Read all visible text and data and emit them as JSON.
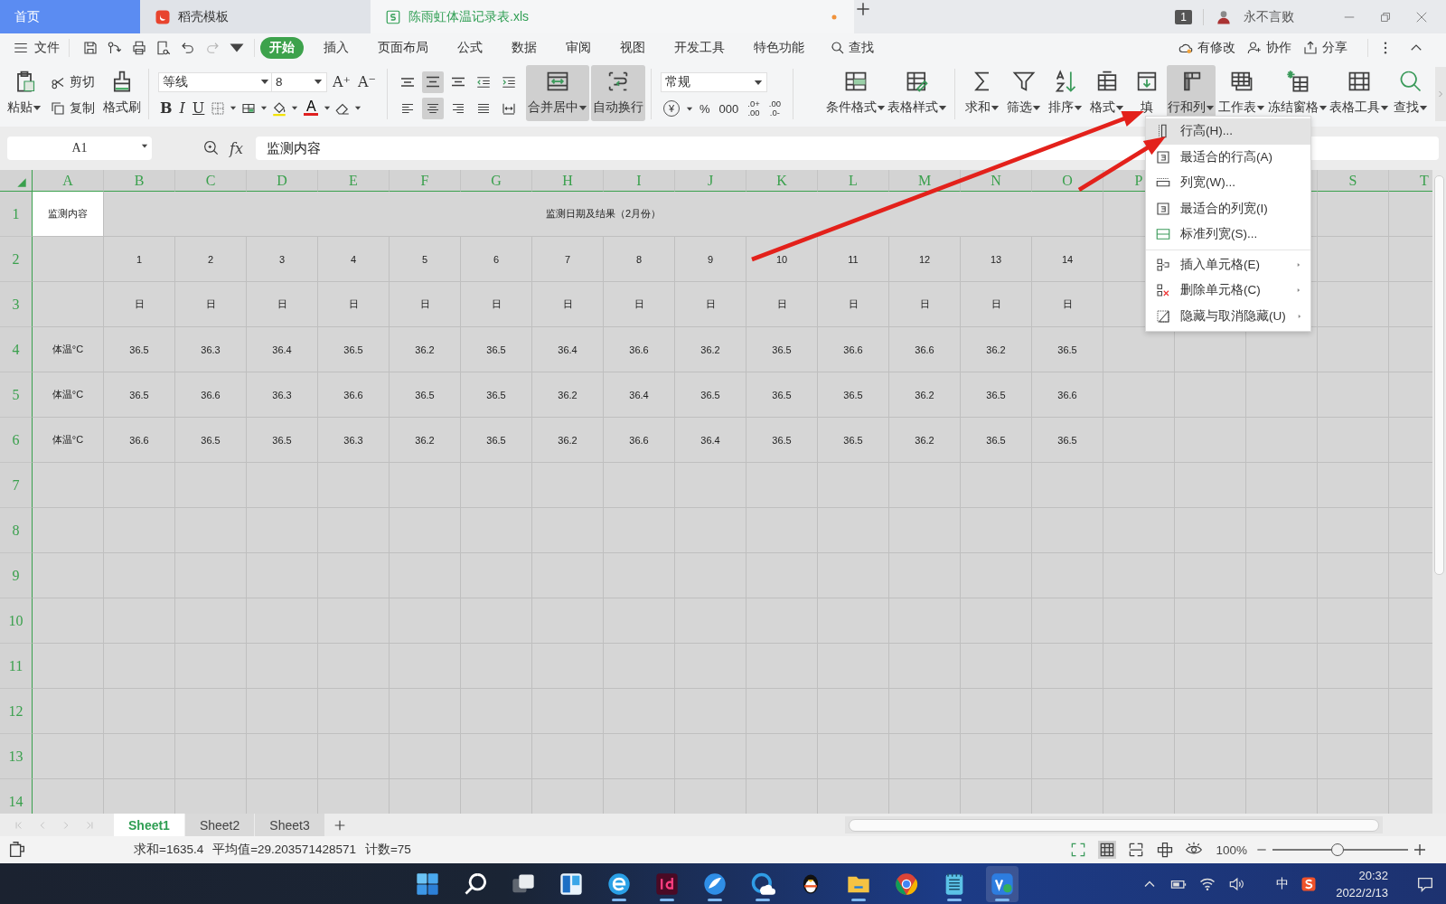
{
  "title_bar": {
    "tabs": [
      {
        "label": "首页",
        "selected": false,
        "kind": "home",
        "modified": false
      },
      {
        "label": "稻壳模板",
        "selected": false,
        "kind": "docer",
        "modified": false
      },
      {
        "label": "陈雨虹体温记录表.xls",
        "selected": true,
        "kind": "sheet",
        "modified": true
      }
    ],
    "page_badge": "1",
    "user_name": "永不言败"
  },
  "menu_bar": {
    "file": "文件",
    "tabs": [
      {
        "label": "开始",
        "selected": true
      },
      {
        "label": "插入",
        "selected": false
      },
      {
        "label": "页面布局",
        "selected": false
      },
      {
        "label": "公式",
        "selected": false
      },
      {
        "label": "数据",
        "selected": false
      },
      {
        "label": "审阅",
        "selected": false
      },
      {
        "label": "视图",
        "selected": false
      },
      {
        "label": "开发工具",
        "selected": false
      },
      {
        "label": "特色功能",
        "selected": false
      }
    ],
    "search": "查找",
    "actions": [
      "有修改",
      "协作",
      "分享"
    ]
  },
  "ribbon": {
    "paste": "粘贴",
    "cut": "剪切",
    "copy": "复制",
    "format_painter": "格式刷",
    "font": "等线",
    "font_size": "8",
    "size_buttons": [
      "A⁺",
      "A⁻"
    ],
    "style_buttons": [
      "B",
      "I",
      "U"
    ],
    "font_color": "A",
    "align_top": [
      {
        "selected": false
      },
      {
        "selected": true
      },
      {
        "selected": false
      },
      {
        "selected": false
      },
      {
        "selected": false
      }
    ],
    "align_bottom": [
      {
        "selected": false
      },
      {
        "selected": true
      },
      {
        "selected": false
      },
      {
        "selected": false
      },
      {
        "selected": false
      }
    ],
    "merge": {
      "label": "合并居中",
      "pressed": true
    },
    "wrap": {
      "label": "自动换行",
      "pressed": true
    },
    "number_format": "常规",
    "number_buttons": [
      {
        "kind": "currency",
        "label": "¥"
      },
      {
        "kind": "plain",
        "label": "%"
      },
      {
        "kind": "plain",
        "label": "000"
      },
      {
        "kind": "decimal",
        "top": ".0+",
        "bottom": ".00"
      },
      {
        "kind": "decimal",
        "top": ".00",
        "bottom": ".0-"
      }
    ],
    "tools": [
      {
        "label": "条件格式",
        "pressed": false
      },
      {
        "label": "表格样式",
        "pressed": false
      },
      {
        "label": "求和",
        "pressed": false
      },
      {
        "label": "筛选",
        "pressed": false
      },
      {
        "label": "排序",
        "pressed": false
      },
      {
        "label": "格式",
        "pressed": false
      },
      {
        "label": "填",
        "pressed": false
      },
      {
        "label": "行和列",
        "pressed": true
      },
      {
        "label": "工作表",
        "pressed": false
      },
      {
        "label": "冻结窗格",
        "pressed": false
      },
      {
        "label": "表格工具",
        "pressed": false
      },
      {
        "label": "查找",
        "pressed": false
      }
    ]
  },
  "formula_bar": {
    "cell": "A1",
    "function_label": "fx",
    "formula": "监测内容"
  },
  "sheet": {
    "columns": [
      "A",
      "B",
      "C",
      "D",
      "E",
      "F",
      "G",
      "H",
      "I",
      "J",
      "K",
      "L",
      "M",
      "N",
      "O",
      "P"
    ],
    "columns_right": [
      "S",
      "T"
    ],
    "rows": [
      "1",
      "2",
      "3",
      "4",
      "5",
      "6",
      "7",
      "8",
      "9",
      "10",
      "11",
      "12",
      "13",
      "14"
    ],
    "title_label": "监测内容",
    "title": "监测日期及结果（2月份）",
    "days": [
      "1",
      "2",
      "3",
      "4",
      "5",
      "6",
      "7",
      "8",
      "9",
      "10",
      "11",
      "12",
      "13",
      "14"
    ],
    "day_unit": [
      "日",
      "日",
      "日",
      "日",
      "日",
      "日",
      "日",
      "日",
      "日",
      "日",
      "日",
      "日",
      "日",
      "日"
    ],
    "readings": [
      {
        "label": "体温°C",
        "values": [
          "36.5",
          "36.3",
          "36.4",
          "36.5",
          "36.2",
          "36.5",
          "36.4",
          "36.6",
          "36.2",
          "36.5",
          "36.6",
          "36.6",
          "36.2",
          "36.5"
        ]
      },
      {
        "label": "体温°C",
        "values": [
          "36.5",
          "36.6",
          "36.3",
          "36.6",
          "36.5",
          "36.5",
          "36.2",
          "36.4",
          "36.5",
          "36.5",
          "36.5",
          "36.2",
          "36.5",
          "36.6"
        ]
      },
      {
        "label": "体温°C",
        "values": [
          "36.6",
          "36.5",
          "36.5",
          "36.3",
          "36.2",
          "36.5",
          "36.2",
          "36.6",
          "36.4",
          "36.5",
          "36.5",
          "36.2",
          "36.5",
          "36.5"
        ]
      }
    ]
  },
  "context_menu": {
    "items": [
      {
        "label": "行高(H)...",
        "selected": true,
        "submenu": false
      },
      {
        "label": "最适合的行高(A)",
        "selected": false,
        "submenu": false
      },
      {
        "label": "列宽(W)...",
        "selected": false,
        "submenu": false
      },
      {
        "label": "最适合的列宽(I)",
        "selected": false,
        "submenu": false
      },
      {
        "label": "标准列宽(S)...",
        "selected": false,
        "submenu": false
      },
      {
        "label": "插入单元格(E)",
        "selected": false,
        "submenu": true
      },
      {
        "label": "删除单元格(C)",
        "selected": false,
        "submenu": true
      },
      {
        "label": "隐藏与取消隐藏(U)",
        "selected": false,
        "submenu": true
      }
    ]
  },
  "sheet_tabs": [
    {
      "label": "Sheet1",
      "selected": true
    },
    {
      "label": "Sheet2",
      "selected": false
    },
    {
      "label": "Sheet3",
      "selected": false
    }
  ],
  "status_bar": {
    "stats": [
      "求和=1635.4",
      "平均值=29.203571428571",
      "计数=75"
    ],
    "zoom": "100%",
    "zoom_slider": {
      "level": 0.48
    }
  },
  "taskbar": {
    "input_method": "中",
    "time": "20:32",
    "date": "2022/2/13"
  }
}
